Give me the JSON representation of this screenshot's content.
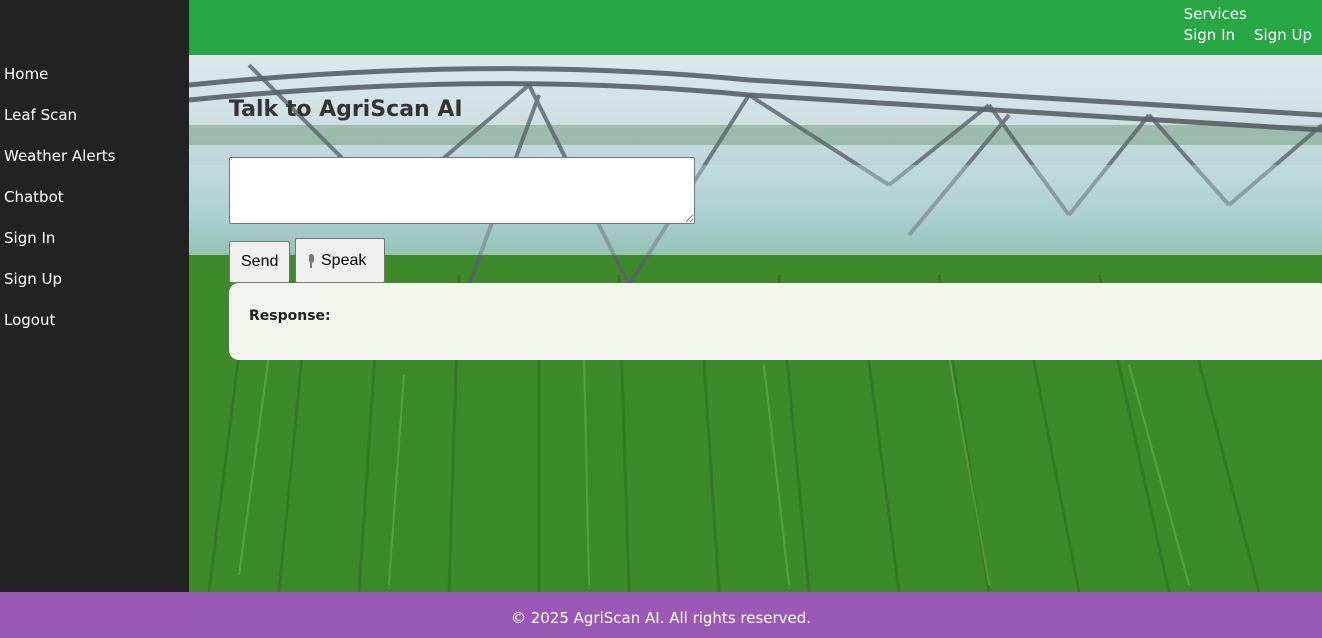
{
  "topnav": {
    "services": "Services",
    "sign_in": "Sign In",
    "sign_up": "Sign Up"
  },
  "sidebar": {
    "items": [
      {
        "label": "Home"
      },
      {
        "label": "Leaf Scan"
      },
      {
        "label": "Weather Alerts"
      },
      {
        "label": "Chatbot"
      },
      {
        "label": "Sign In"
      },
      {
        "label": "Sign Up"
      },
      {
        "label": "Logout"
      }
    ]
  },
  "chat": {
    "title": "Talk to AgriScan AI",
    "input_value": "",
    "send_label": "Send",
    "speak_label": "Speak",
    "response_label": "Response:"
  },
  "footer": {
    "text": "© 2025 AgriScan AI. All rights reserved."
  },
  "colors": {
    "topbar": "#28a745",
    "sidebar": "#222222",
    "footer": "#9b59b6"
  },
  "icons": {
    "speak": "microphone-icon"
  }
}
